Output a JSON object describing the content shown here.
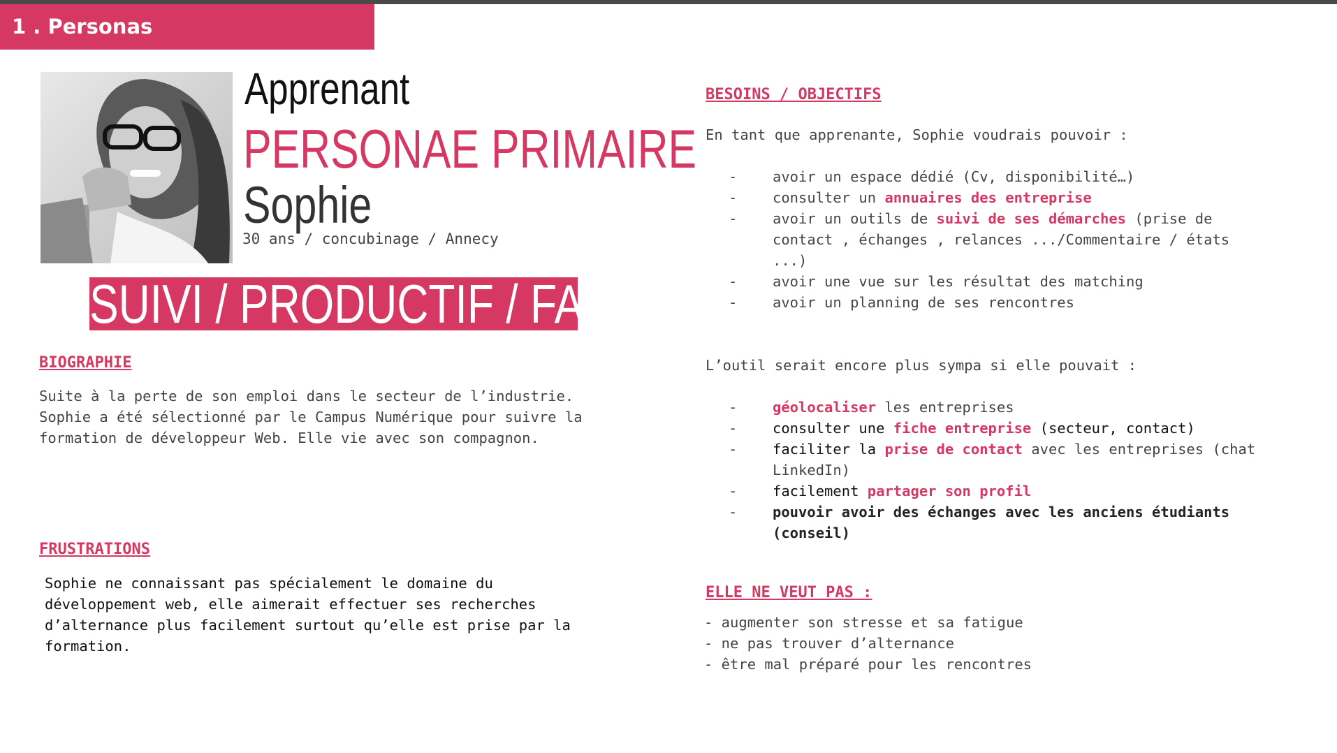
{
  "header": {
    "title": "1 . Personas"
  },
  "persona": {
    "role": "Apprenant",
    "type": "PERSONAE PRIMAIRE",
    "name": "Sophie",
    "details": "30 ans / concubinage / Annecy",
    "keywords": "SUIVI / PRODUCTIF / FACILITE"
  },
  "biography": {
    "title": "BIOGRAPHIE",
    "lines": [
      "Suite à la perte de son emploi dans le secteur de l’industrie.",
      "Sophie a été sélectionné par le Campus Numérique pour suivre la",
      "formation de développeur Web. Elle vie avec son compagnon."
    ]
  },
  "frustrations": {
    "title": "FRUSTRATIONS",
    "lines": [
      "Sophie ne connaissant pas spécialement le domaine du",
      "développement web, elle aimerait effectuer ses recherches",
      "d’alternance plus facilement surtout qu’elle est prise par la",
      "formation."
    ]
  },
  "needs": {
    "title": "BESOINS / OBJECTIFS",
    "intro": "En tant que apprenante, Sophie voudrais pouvoir :",
    "items": [
      {
        "a": "avoir un espace dédié (Cv, disponibilité…)",
        "h": "",
        "b": ""
      },
      {
        "a": "consulter un ",
        "h": "annuaires des entreprise",
        "b": ""
      },
      {
        "a": "avoir un outils de ",
        "h": "suivi de ses démarches",
        "b": " (prise de contact , échanges , relances .../Commentaire / états ...)"
      },
      {
        "a": "avoir une vue sur les résultat des matching",
        "h": "",
        "b": ""
      },
      {
        "a": "avoir un planning de ses rencontres",
        "h": "",
        "b": ""
      }
    ],
    "intro2": "L’outil serait encore plus sympa si elle pouvait :",
    "items2": [
      {
        "a": "",
        "h": "géolocaliser",
        "b": " les entreprises"
      },
      {
        "a": "consulter une ",
        "h": "fiche entreprise",
        "b": " (secteur, contact)"
      },
      {
        "a": "faciliter la ",
        "h": "prise de contact",
        "b": " avec les entreprises (chat LinkedIn)"
      },
      {
        "a": "facilement ",
        "h": "partager son profil",
        "b": ""
      },
      {
        "a": "",
        "h": "",
        "b": "pouvoir avoir des échanges avec les anciens étudiants (conseil)"
      }
    ]
  },
  "donts": {
    "title": "ELLE NE VEUT PAS :",
    "items": [
      "- augmenter son stresse et sa fatigue",
      "- ne pas trouver d’alternance",
      "- être mal préparé pour les rencontres"
    ]
  },
  "icons": {
    "photo": "persona-photo"
  },
  "colors": {
    "accent": "#d63864",
    "topbar": "#4a4a4a"
  }
}
